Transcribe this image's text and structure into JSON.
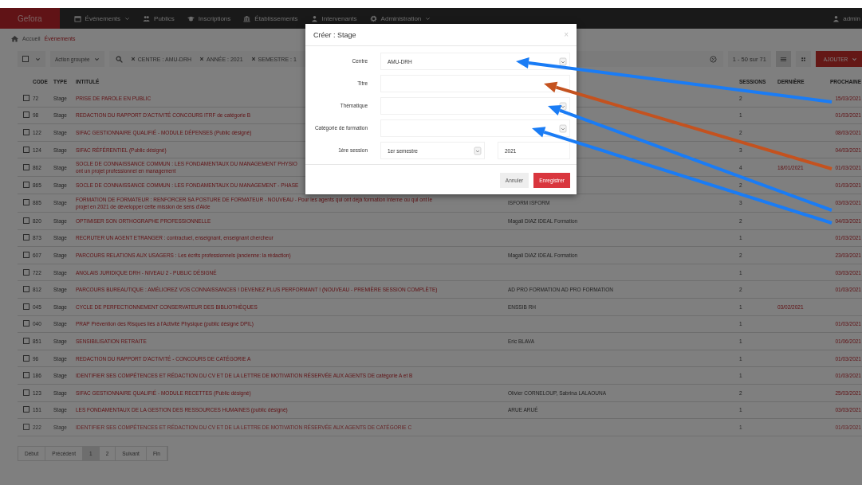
{
  "navbar": {
    "logo": "Gefora",
    "items": [
      {
        "label": "Événements",
        "dropdown": true
      },
      {
        "label": "Publics",
        "dropdown": false
      },
      {
        "label": "Inscriptions",
        "dropdown": false
      },
      {
        "label": "Établissements",
        "dropdown": false
      },
      {
        "label": "Intervenants",
        "dropdown": false
      },
      {
        "label": "Administration",
        "dropdown": true
      }
    ],
    "user": "admin"
  },
  "breadcrumb": [
    "Accueil",
    "Événements"
  ],
  "toolbar": {
    "bulk_action": "Action groupée",
    "filters": [
      "CENTRE : AMU-DRH",
      "ANNÉE : 2021",
      "SEMESTRE : 1"
    ],
    "count": "1 - 50 sur 71",
    "add_button": "AJOUTER"
  },
  "table": {
    "columns": [
      "CODE",
      "TYPE",
      "INTITULÉ",
      "SESSIONS",
      "DERNIÈRE",
      "PROCHAINE"
    ],
    "rows": [
      {
        "checked": false,
        "code": "72",
        "type": "Stage",
        "title": "PRISE DE PAROLE EN PUBLIC",
        "speakers": "",
        "sessions": "2",
        "last": "",
        "next": "15/03/2021"
      },
      {
        "checked": false,
        "code": "98",
        "type": "Stage",
        "title": "REDACTION DU RAPPORT D'ACTIVITÉ CONCOURS ITRF de catégorie B",
        "speakers": "",
        "sessions": "1",
        "last": "",
        "next": "01/03/2021"
      },
      {
        "checked": false,
        "code": "122",
        "type": "Stage",
        "title": "SIFAC GESTIONNAIRE QUALIFIÉ - MODULE DÉPENSES (Public désigné)",
        "speakers": "",
        "sessions": "2",
        "last": "",
        "next": "08/03/2021"
      },
      {
        "checked": false,
        "code": "124",
        "type": "Stage",
        "title": "SIFAC RÉFÉRENTIEL (Public désigné)",
        "speakers": "",
        "sessions": "3",
        "last": "",
        "next": "04/03/2021"
      },
      {
        "checked": false,
        "code": "862",
        "type": "Stage",
        "title": "SOCLE DE CONNAISSANCE COMMUN : LES FONDAMENTAUX DU MANAGEMENT PHYSIO",
        "title_2": "ont un projet professionnel en management",
        "speakers": "",
        "sessions": "4",
        "last": "18/01/2021",
        "next": "01/03/2021"
      },
      {
        "checked": false,
        "code": "865",
        "type": "Stage",
        "title": "SOCLE DE CONNAISSANCE COMMUN : LES FONDAMENTAUX DU MANAGEMENT - PHASE",
        "speakers": "",
        "sessions": "2",
        "last": "",
        "next": "01/03/2021"
      },
      {
        "checked": false,
        "code": "885",
        "type": "Stage",
        "title": "FORMATION DE FORMATEUR : RENFORCER SA POSTURE DE FORMATEUR - NOUVEAU - Pour les agents qui ont déjà formation interne ou qui ont le",
        "title_2": "projet en 2021 de développer cette mission de sens d'Aide",
        "speakers": "ISFORM ISFORM",
        "sessions": "3",
        "last": "",
        "next": "03/03/2021"
      },
      {
        "checked": false,
        "code": "820",
        "type": "Stage",
        "title": "OPTIMISER SON ORTHOGRAPHE PROFESSIONNELLE",
        "speakers": "Magali DIAZ IDEAL Formation",
        "sessions": "2",
        "last": "",
        "next": "04/03/2021"
      },
      {
        "checked": false,
        "code": "873",
        "type": "Stage",
        "title": "RECRUTER UN AGENT ETRANGER : contractuel, enseignant, enseignant chercheur",
        "speakers": "",
        "sessions": "1",
        "last": "",
        "next": "01/03/2021"
      },
      {
        "checked": false,
        "code": "607",
        "type": "Stage",
        "title": "PARCOURS RELATIONS AUX USAGERS : Les écrits professionnels (ancienne: la rédaction)",
        "speakers": "Magali DIAZ IDEAL Formation",
        "sessions": "2",
        "last": "",
        "next": "23/03/2021"
      },
      {
        "checked": false,
        "code": "722",
        "type": "Stage",
        "title": "ANGLAIS JURIDIQUE DRH - NIVEAU 2 - PUBLIC DÉSIGNÉ",
        "speakers": "",
        "sessions": "1",
        "last": "",
        "next": "03/03/2021"
      },
      {
        "checked": false,
        "code": "812",
        "type": "Stage",
        "title": "PARCOURS BUREAUTIQUE : AMÉLIOREZ VOS CONNAISSANCES ! DEVENEZ PLUS PERFORMANT ! (NOUVEAU - PREMIÈRE SESSION COMPLÈTE)",
        "speakers": "AD PRO FORMATION AD PRO FORMATION",
        "sessions": "2",
        "last": "",
        "next": "01/03/2021"
      },
      {
        "checked": false,
        "code": "045",
        "type": "Stage",
        "title": "CYCLE DE PERFECTIONNEMENT CONSERVATEUR DES BIBLIOTHÈQUES",
        "speakers": "ENSSIB RH",
        "sessions": "1",
        "last": "03/02/2021",
        "next": ""
      },
      {
        "checked": false,
        "code": "040",
        "type": "Stage",
        "title": "PRAP Prévention des Risques liés à l'Activité Physique (public désigné DPIL)",
        "speakers": "",
        "sessions": "1",
        "last": "",
        "next": "01/03/2021"
      },
      {
        "checked": false,
        "code": "851",
        "type": "Stage",
        "title": "SENSIBILISATION RETRAITE",
        "speakers": "Eric BLAVA",
        "sessions": "1",
        "last": "",
        "next": "01/06/2021"
      },
      {
        "checked": false,
        "code": "96",
        "type": "Stage",
        "title": "REDACTION DU RAPPORT D'ACTIVITÉ - CONCOURS DE CATÉGORIE A",
        "speakers": "",
        "sessions": "1",
        "last": "",
        "next": "01/03/2021"
      },
      {
        "checked": false,
        "code": "186",
        "type": "Stage",
        "title": "IDENTIFIER SES COMPÉTENCES ET RÉDACTION DU CV ET DE LA LETTRE DE MOTIVATION RÉSERVÉE AUX AGENTS DE catégorie A et B",
        "speakers": "",
        "sessions": "1",
        "last": "",
        "next": "01/03/2021"
      },
      {
        "checked": false,
        "code": "123",
        "type": "Stage",
        "title": "SIFAC GESTIONNAIRE QUALIFIÉ - MODULE RECETTES (Public désigné)",
        "speakers": "Olivier CORNELOUP, Sabrina LALAOUNA",
        "sessions": "2",
        "last": "",
        "next": "25/03/2021"
      },
      {
        "checked": false,
        "code": "151",
        "type": "Stage",
        "title": "LES FONDAMENTAUX DE LA GESTION DES RESSOURCES HUMAINES (public désigné)",
        "speakers": "ARUE ARUÉ",
        "sessions": "1",
        "last": "",
        "next": "03/03/2021"
      },
      {
        "checked": false,
        "code": "222",
        "type": "Stage",
        "title": "IDENTIFIER SES COMPÉTENCES ET RÉDACTION DU CV ET DE LA LETTRE DE MOTIVATION RÉSERVÉE AUX AGENTS DE CATÉGORIE C",
        "speakers": "",
        "sessions": "1",
        "last": "",
        "next": "01/03/2021"
      }
    ]
  },
  "pagination": [
    {
      "label": "Début",
      "selected": false
    },
    {
      "label": "Précédent",
      "selected": false
    },
    {
      "label": "1",
      "selected": true
    },
    {
      "label": "2",
      "selected": false
    },
    {
      "label": "Suivant",
      "selected": false
    },
    {
      "label": "Fin",
      "selected": false
    }
  ],
  "modal": {
    "title": "Créer : Stage",
    "close": "×",
    "arrows": [
      {
        "color": "#1a7cf5"
      },
      {
        "color": "#c4521f"
      },
      {
        "color": "#1a7cf5"
      },
      {
        "color": "#1a7cf5"
      }
    ],
    "fields": [
      {
        "label": "Centre",
        "kind": "select",
        "value": "AMU-DRH"
      },
      {
        "label": "Titre",
        "kind": "input"
      },
      {
        "label": "Thématique",
        "kind": "select"
      },
      {
        "label": "Catégorie de formation",
        "kind": "select"
      },
      {
        "label": "1ère session",
        "kind": "session",
        "value": "1er semestre",
        "year": "2021"
      }
    ],
    "buttons": [
      {
        "label": "Annuler",
        "kind": "secondary"
      },
      {
        "label": "Enregistrer",
        "kind": "primary"
      }
    ]
  }
}
